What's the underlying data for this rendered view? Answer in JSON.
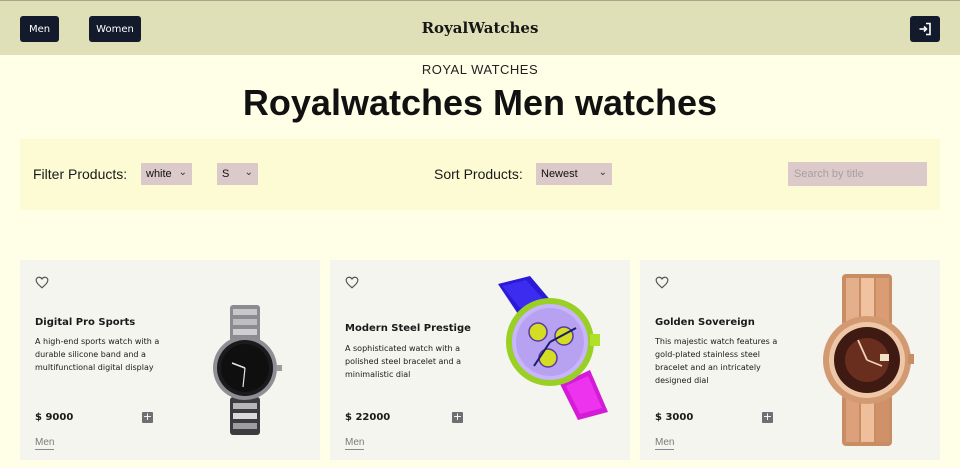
{
  "header": {
    "nav": [
      "Men",
      "Women"
    ],
    "brand": "RoyalWatches",
    "login_icon": "login-icon"
  },
  "hero": {
    "kicker": "ROYAL WATCHES",
    "title": "Royalwatches Men watches"
  },
  "filters": {
    "filter_label": "Filter Products:",
    "color_value": "white",
    "size_value": "S",
    "sort_label": "Sort Products:",
    "sort_value": "Newest",
    "search_placeholder": "Search by title"
  },
  "products": [
    {
      "title": "Digital Pro Sports",
      "description": "A high-end sports watch with a durable silicone band and a multifunctional digital display",
      "price": "$ 9000",
      "category": "Men",
      "watch_style": "black-steel-watch"
    },
    {
      "title": "Modern Steel Prestige",
      "description": "A sophisticated watch with a polished steel bracelet and a minimalistic dial",
      "price": "$ 22000",
      "category": "Men",
      "watch_style": "colorful-chronograph-watch"
    },
    {
      "title": "Golden Sovereign",
      "description": "This majestic watch features a gold-plated stainless steel bracelet and an intricately designed dial",
      "price": "$ 3000",
      "category": "Men",
      "watch_style": "gold-dress-watch"
    }
  ],
  "colors": {
    "header_bg": "#dfdfb8",
    "page_bg": "#ffffe7",
    "button_dark": "#131a2c",
    "select_bg": "#dcc9c9",
    "filter_bar_bg": "#fdfbd3",
    "card_bg": "#f5f5ef"
  }
}
